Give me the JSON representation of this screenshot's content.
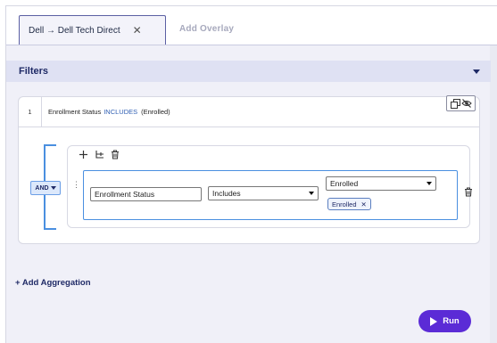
{
  "tabs": {
    "active_label": "Dell → Dell Tech Direct",
    "close_glyph": "✕",
    "add_label": "Add Overlay"
  },
  "filters": {
    "title": "Filters",
    "summary_row": {
      "index": "1",
      "field": "Enrollment Status",
      "operator": "INCLUDES",
      "value": "(Enrolled)"
    },
    "group": {
      "logic": "AND",
      "condition": {
        "field": "Enrollment Status",
        "operator": "Includes",
        "selected_value": "Enrolled",
        "chip_label": "Enrolled",
        "chip_remove": "✕"
      }
    }
  },
  "aggregation": {
    "label": "+ Add Aggregation"
  },
  "run": {
    "label": "Run"
  },
  "colors": {
    "accent": "#5b2bd6",
    "group_border": "#4a8fe0",
    "header_bg": "#dfe1f3",
    "operator_text": "#2f5fb3"
  },
  "icons": [
    "close-icon",
    "chevron-down-icon",
    "copy-icon",
    "eye-off-icon",
    "plus-icon",
    "branch-icon",
    "trash-icon",
    "drag-handle-icon",
    "play-icon"
  ]
}
